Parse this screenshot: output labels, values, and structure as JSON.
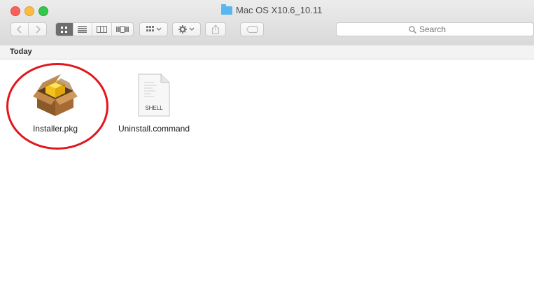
{
  "window": {
    "title": "Mac OS X10.6_10.11"
  },
  "toolbar": {
    "back_icon": "chevron-left-icon",
    "forward_icon": "chevron-right-icon",
    "view_modes": [
      "icon-view",
      "list-view",
      "column-view",
      "coverflow-view"
    ],
    "active_view": "icon-view",
    "arrange_icon": "arrange-grid-icon",
    "action_icon": "gear-icon",
    "share_icon": "share-icon",
    "tag_icon": "tag-icon"
  },
  "search": {
    "placeholder": "Search",
    "icon": "magnifier-icon"
  },
  "section": {
    "label": "Today"
  },
  "files": [
    {
      "name": "Installer.pkg",
      "icon": "package-box-icon",
      "highlighted": true
    },
    {
      "name": "Uninstall.command",
      "icon": "shell-document-icon",
      "icon_text": "SHELL"
    }
  ],
  "colors": {
    "highlight_circle": "#e3161b",
    "folder": "#5ab7ee"
  }
}
